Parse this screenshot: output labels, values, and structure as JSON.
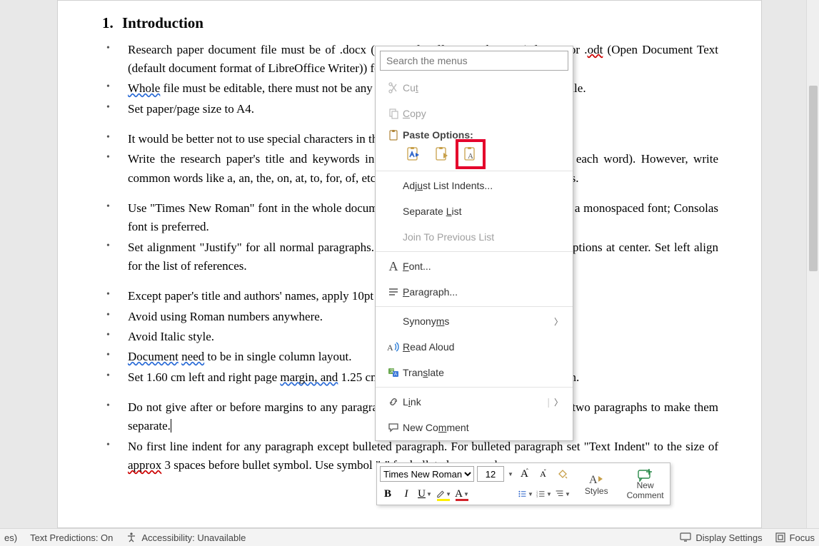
{
  "heading": {
    "number": "1.",
    "title": "Introduction"
  },
  "bullets": {
    "g1": [
      "Research paper document file must be of .docx (Microsoft Office Word 2007+) format or .<span class='spellerr'>odt</span> (Open Document Text (default document format of LibreOffice Writer)) format.",
      "<span class='gramerr'>Whole</span> file must be editable, there must not be any embedded images inside the document file.",
      "Set paper/page size to A4."
    ],
    "g2": [
      "It would be better not to use special characters in the paper's title, abstract and keywords.",
      "Write the research paper's title and keywords in title case (capitalize first character of each word). However, write common words like a, an, the, on, at, to, for, of, etc. in lower case in both title and keywords."
    ],
    "g3": [
      "Use \"Times New Roman\" font in the whole document. Only programming code may be in a monospaced font; Consolas font is preferred.",
      "Set alignment \"Justify\" for all normal paragraphs. Set images, tables, figures, and their captions at center. Set left align for the list of references."
    ],
    "g4": [
      "Except paper's title and authors' names, apply 10pt font size for the document's content.",
      "Avoid using Roman numbers anywhere.",
      "Avoid Italic style.",
      "<span class='gramerr'>Document</span> <span class='gramerr'>need</span> to be in single column layout.",
      "Set 1.60 cm left and right page <span class='gramerr'>margin, and</span> 1.25 cm top margin, and 1.60 cm bottom margin."
    ],
    "g5": [
      "Do not give after or before margins to any paragraph. Add one empty <span class='gramerr'>paragraph</span> between two paragraphs to make them separate.<span class='cursor-bar'></span>",
      "No first line indent for any paragraph except bulleted paragraph. For bulleted paragraph set \"Text Indent\" to the size of <span class='spellerr'>approx</span> 3 spaces before bullet symbol. Use symbol \"•\" for bulleted paragraphs."
    ]
  },
  "context_menu": {
    "search_placeholder": "Search the menus",
    "cut": "Cut",
    "copy": "Copy",
    "paste_options": "Paste Options:",
    "adjust_indents": "Adjust List Indents...",
    "separate_list": "Separate List",
    "join_previous": "Join To Previous List",
    "font": "Font...",
    "paragraph": "Paragraph...",
    "synonyms": "Synonyms",
    "read_aloud": "Read Aloud",
    "translate": "Translate",
    "link": "Link",
    "new_comment": "New Comment"
  },
  "mini_toolbar": {
    "font": "Times New Roman",
    "size": "12",
    "styles": "Styles",
    "new_comment_l1": "New",
    "new_comment_l2": "Comment"
  },
  "status_bar": {
    "left_trunc": "es)",
    "predictions": "Text Predictions: On",
    "accessibility": "Accessibility: Unavailable",
    "display": "Display Settings",
    "focus": "Focus"
  }
}
